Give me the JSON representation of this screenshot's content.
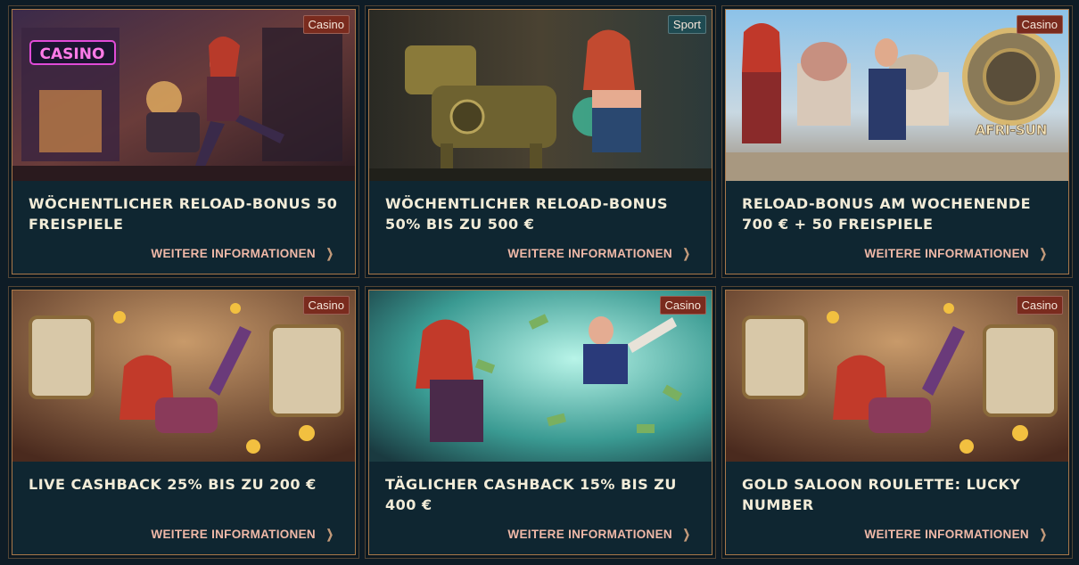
{
  "promotions": [
    {
      "title": "WÖCHENTLICHER RELOAD-BONUS 50 FREISPIELE",
      "category": "Casino",
      "link": "WEITERE INFORMATIONEN",
      "art_sign": "CASINO"
    },
    {
      "title": "WÖCHENTLICHER RELOAD-BONUS 50% BIS ZU 500 €",
      "category": "Sport",
      "link": "WEITERE INFORMATIONEN"
    },
    {
      "title": "RELOAD-BONUS AM WOCHENENDE 700 € + 50 FREISPIELE",
      "category": "Casino",
      "link": "WEITERE INFORMATIONEN",
      "art_sign": "AFRI-SUN"
    },
    {
      "title": "LIVE CASHBACK 25% BIS ZU 200 €",
      "category": "Casino",
      "link": "WEITERE INFORMATIONEN"
    },
    {
      "title": "TÄGLICHER CASHBACK 15% BIS ZU 400 €",
      "category": "Casino",
      "link": "WEITERE INFORMATIONEN"
    },
    {
      "title": "GOLD SALOON ROULETTE: LUCKY NUMBER",
      "category": "Casino",
      "link": "WEITERE INFORMATIONEN"
    }
  ],
  "icons": {
    "link_arrow": "chevron-right-icon"
  },
  "colors": {
    "casino_badge": "#7a2b1e",
    "sport_badge": "#1f4b52",
    "card_border": "#a9784a",
    "link_text": "#f0b9a8"
  }
}
